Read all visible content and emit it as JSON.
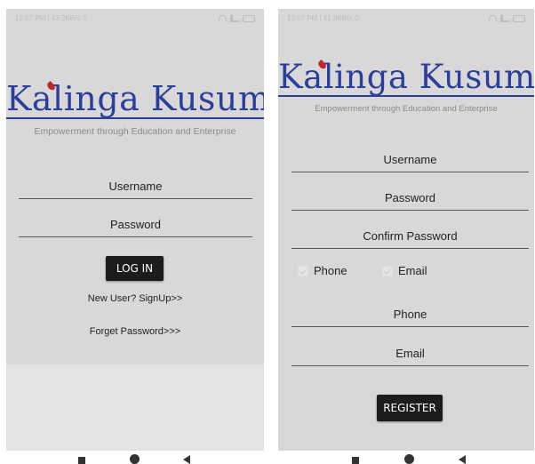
{
  "left_screen": {
    "status": {
      "time": "12:07 PM | 43.2KB/s ⏱"
    },
    "logo": {
      "title": "Kalinga Kusum",
      "tagline": "Empowerment through Education and Enterprise"
    },
    "form": {
      "username_label": "Username",
      "password_label": "Password",
      "login_button": "LOG IN",
      "signup_link": "New User? SignUp>>",
      "forgot_link": "Forget Password>>>"
    }
  },
  "right_screen": {
    "status": {
      "time": "12:07 PM | 41.3KB/s ⏱"
    },
    "logo": {
      "title": "Kalinga Kusum",
      "tagline": "Empowerment through Education and Enterprise"
    },
    "form": {
      "username_label": "Username",
      "password_label": "Password",
      "confirm_password_label": "Confirm Password",
      "phone_option": "Phone",
      "email_option": "Email",
      "phone_label": "Phone",
      "email_label": "Email",
      "register_button": "REGISTER"
    }
  },
  "icons": [
    "wifi-icon",
    "signal-icon",
    "battery-icon",
    "drop-icon",
    "check-icon",
    "recent-apps-icon",
    "home-icon",
    "back-icon"
  ],
  "colors": {
    "brand": "#2c3e9b",
    "drop": "#c0262e",
    "screen_bg": "#d9d8d9",
    "button_bg": "#1c1c1c"
  }
}
